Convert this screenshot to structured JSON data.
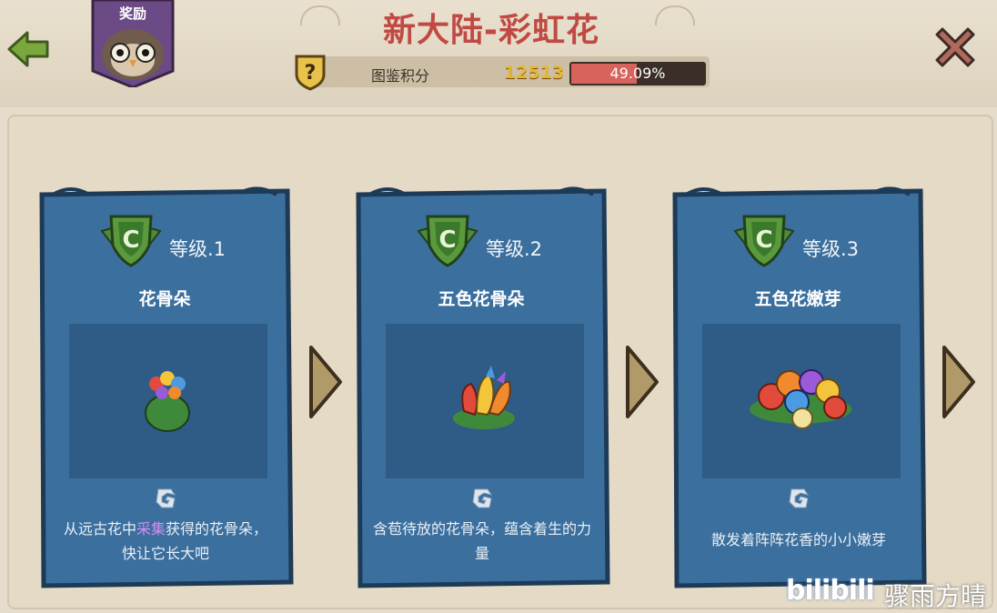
{
  "header": {
    "title": "新大陆-彩虹花",
    "reward_label": "奖励",
    "score_label": "图鉴积分",
    "score_value": "12513",
    "progress_text": "49.09%",
    "progress_fraction": 0.4909
  },
  "cards": [
    {
      "level": "等级.1",
      "name": "花骨朵",
      "desc_pre": "从远古花中",
      "desc_hl": "采集",
      "desc_post": "获得的花骨朵，快让它长大吧"
    },
    {
      "level": "等级.2",
      "name": "五色花骨朵",
      "desc_pre": "含苞待放的花骨朵，蕴含着生的力量",
      "desc_hl": "",
      "desc_post": ""
    },
    {
      "level": "等级.3",
      "name": "五色花嫩芽",
      "desc_pre": "散发着阵阵花香的小小嫩芽",
      "desc_hl": "",
      "desc_post": ""
    }
  ],
  "watermark": {
    "logo": "bilibili",
    "name": "骤雨方晴"
  },
  "colors": {
    "title": "#c04a43",
    "card_bg": "#3b6f9e",
    "highlight": "#d98bf0",
    "score": "#e8b52e"
  },
  "icons": {
    "back": "back-arrow-icon",
    "close": "close-x-icon",
    "badge": "question-badge-icon",
    "grade": "c-grade-shield-icon",
    "next": "next-arrow-icon",
    "g": "g-rune-icon"
  }
}
